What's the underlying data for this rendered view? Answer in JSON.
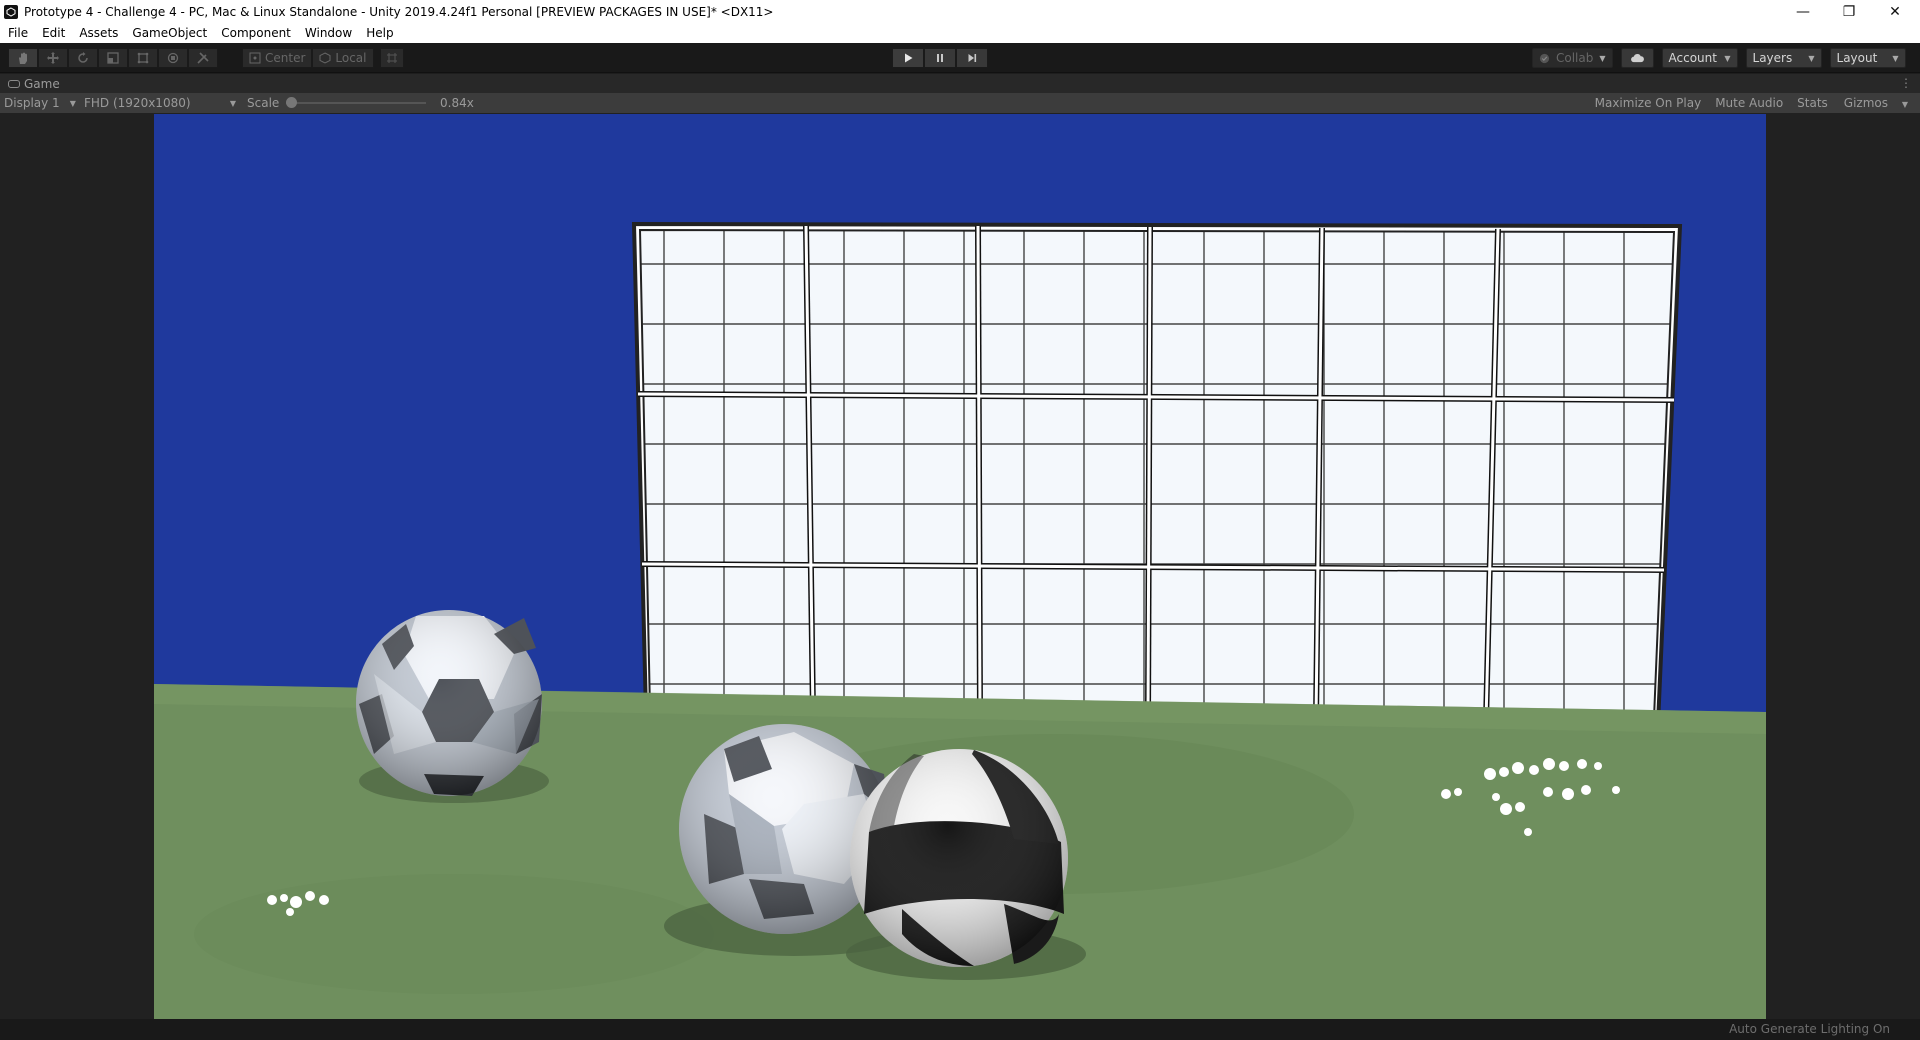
{
  "window": {
    "title": "Prototype 4 - Challenge 4 - PC, Mac & Linux Standalone - Unity 2019.4.24f1 Personal [PREVIEW PACKAGES IN USE]* <DX11>",
    "minimize_glyph": "—",
    "maximize_glyph": "❐",
    "close_glyph": "✕"
  },
  "menu": [
    "File",
    "Edit",
    "Assets",
    "GameObject",
    "Component",
    "Window",
    "Help"
  ],
  "toolbar": {
    "tools": [
      "hand-tool",
      "move-tool",
      "rotate-tool",
      "scale-tool",
      "rect-tool",
      "transform-tool",
      "custom-tool"
    ],
    "pivot_label": "Center",
    "space_label": "Local",
    "collab_label": "Collab",
    "account_label": "Account",
    "layers_label": "Layers",
    "layout_label": "Layout"
  },
  "game_tab": {
    "label": "Game"
  },
  "game_controls": {
    "display": "Display 1",
    "resolution": "FHD (1920x1080)",
    "scale_label": "Scale",
    "scale_value": "0.84x",
    "maximize_on_play": "Maximize On Play",
    "mute_audio": "Mute Audio",
    "stats": "Stats",
    "gizmos": "Gizmos"
  },
  "status": {
    "text": "Auto Generate Lighting On"
  },
  "colors": {
    "sky": "#1f399d",
    "ground": "#6f8f5e",
    "accent_active": "#3c3c3c"
  }
}
